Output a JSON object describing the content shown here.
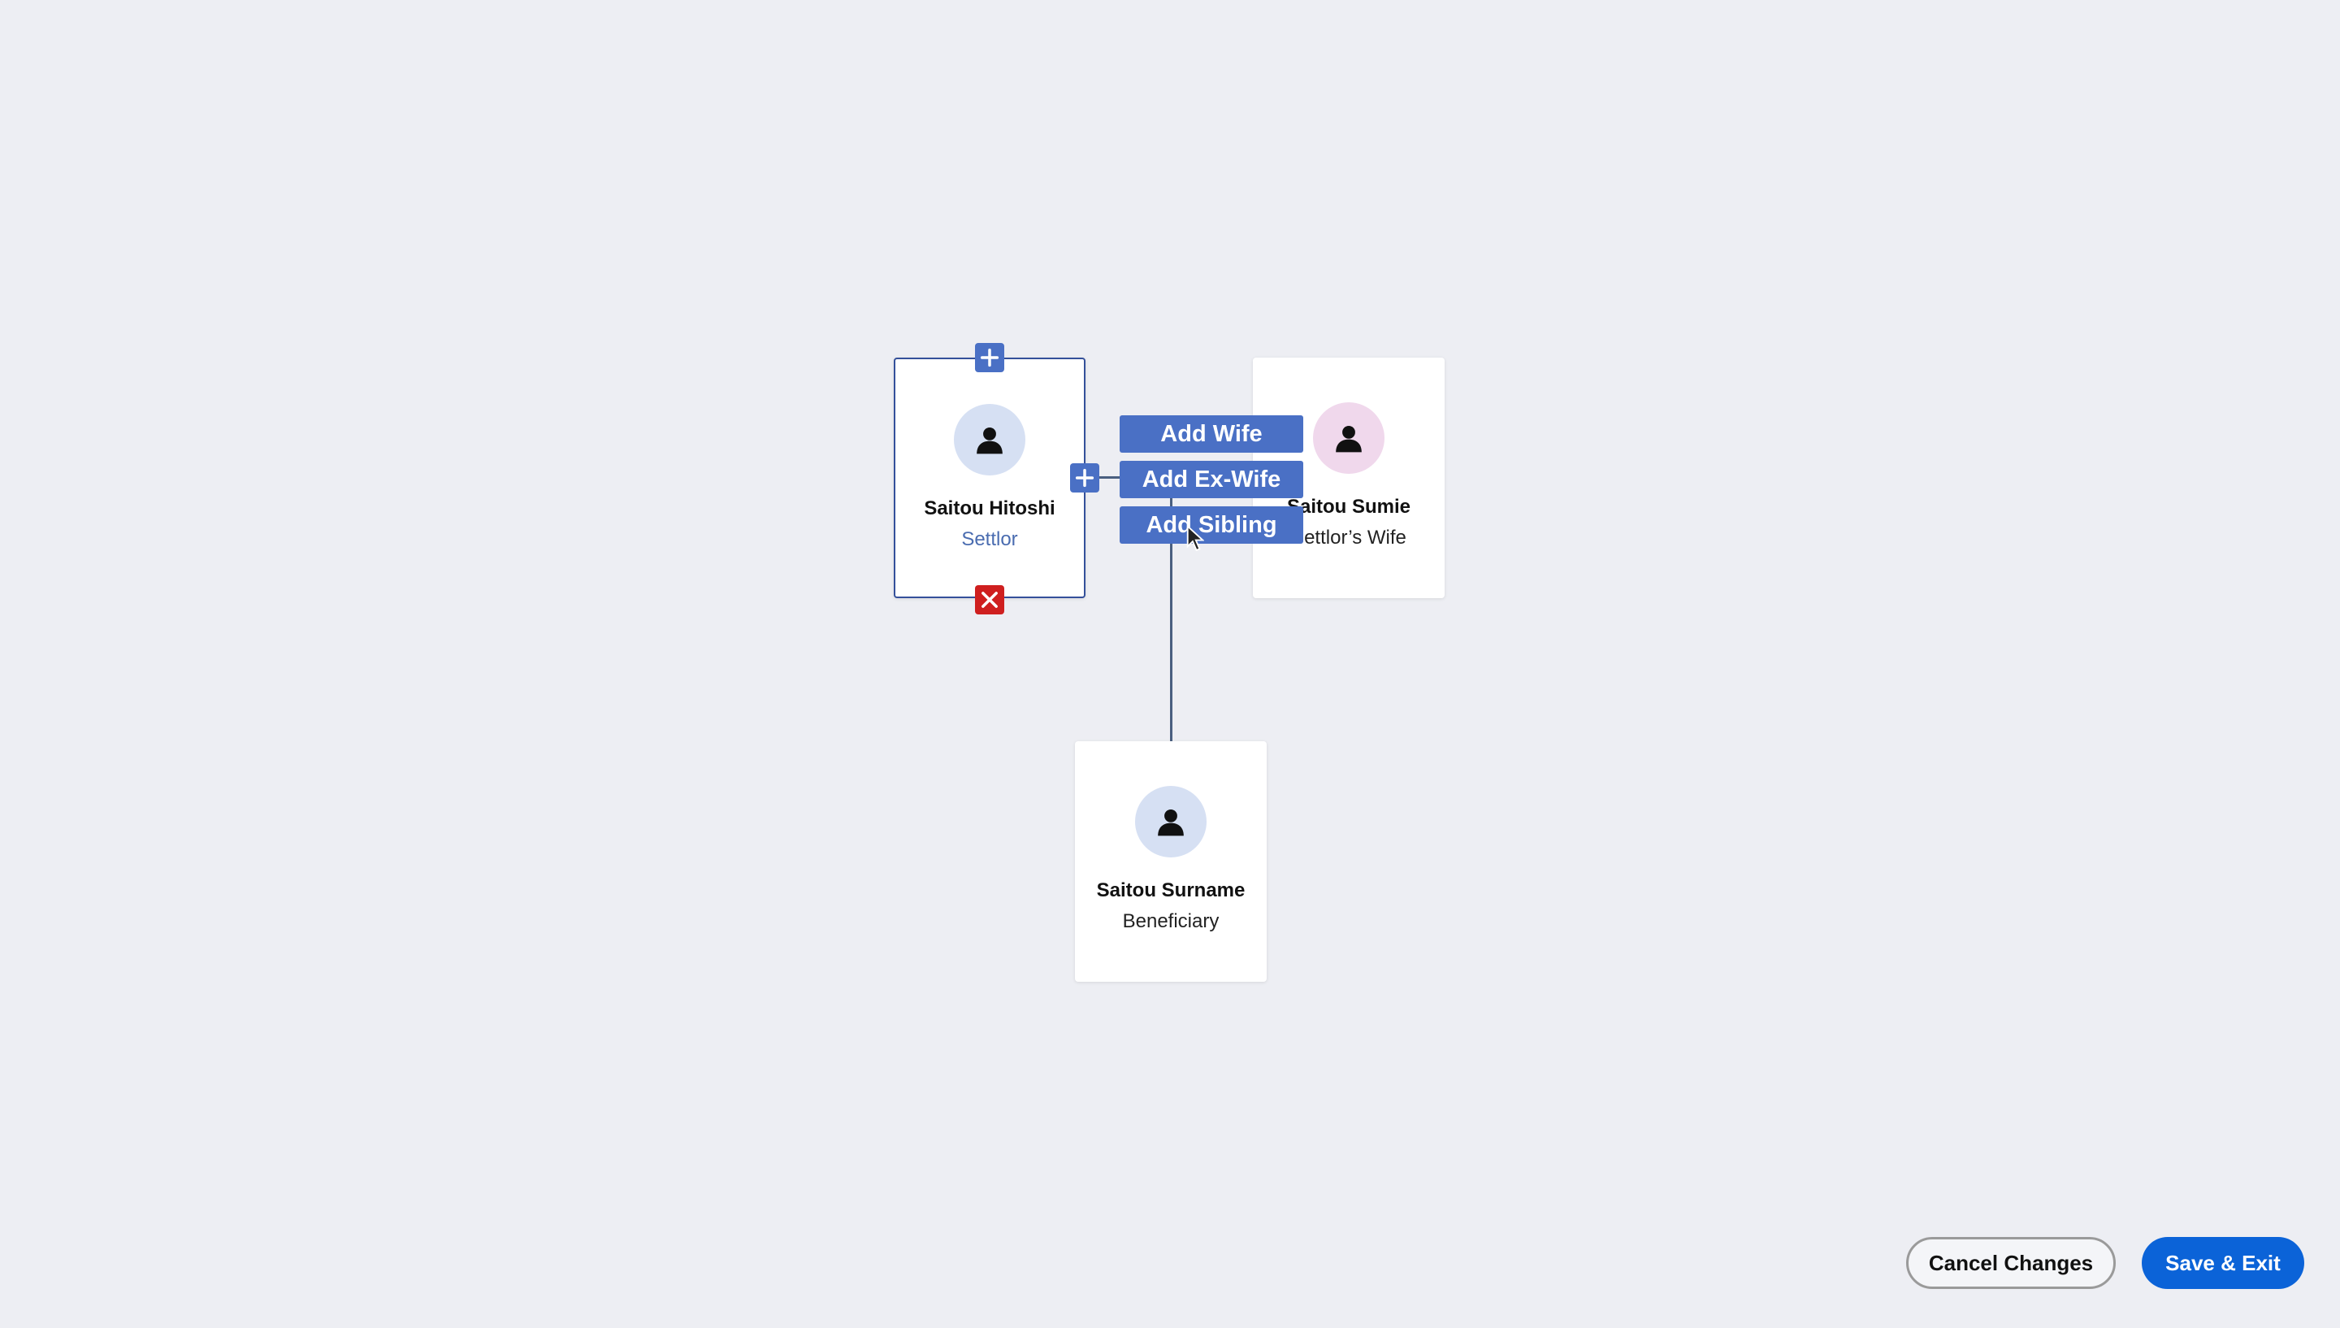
{
  "colors": {
    "background": "#edeef3",
    "accent": "#4a70c5",
    "delete": "#cf1f1f",
    "selected_border": "#34509a",
    "male_avatar": "#d6e0f3",
    "female_avatar": "#f0d8ec",
    "primary_button": "#0b63d8"
  },
  "cards": [
    {
      "name": "Saitou Hitoshi",
      "role": "Settlor",
      "avatar_icon": "person-icon",
      "selected": true
    },
    {
      "name": "Saitou Sumie",
      "role": "Settlor’s Wife",
      "avatar_icon": "person-icon",
      "selected": false
    },
    {
      "name": "Saitou Surname",
      "role": "Beneficiary",
      "avatar_icon": "person-icon",
      "selected": false
    }
  ],
  "controls": {
    "add_top_icon": "plus-icon",
    "add_right_icon": "plus-icon",
    "delete_icon": "close-icon"
  },
  "relation_menu": {
    "items": [
      "Add Wife",
      "Add Ex-Wife",
      "Add Sibling"
    ]
  },
  "cursor_icon": "mouse-pointer-icon",
  "footer": {
    "cancel_label": "Cancel Changes",
    "save_label": "Save & Exit"
  }
}
